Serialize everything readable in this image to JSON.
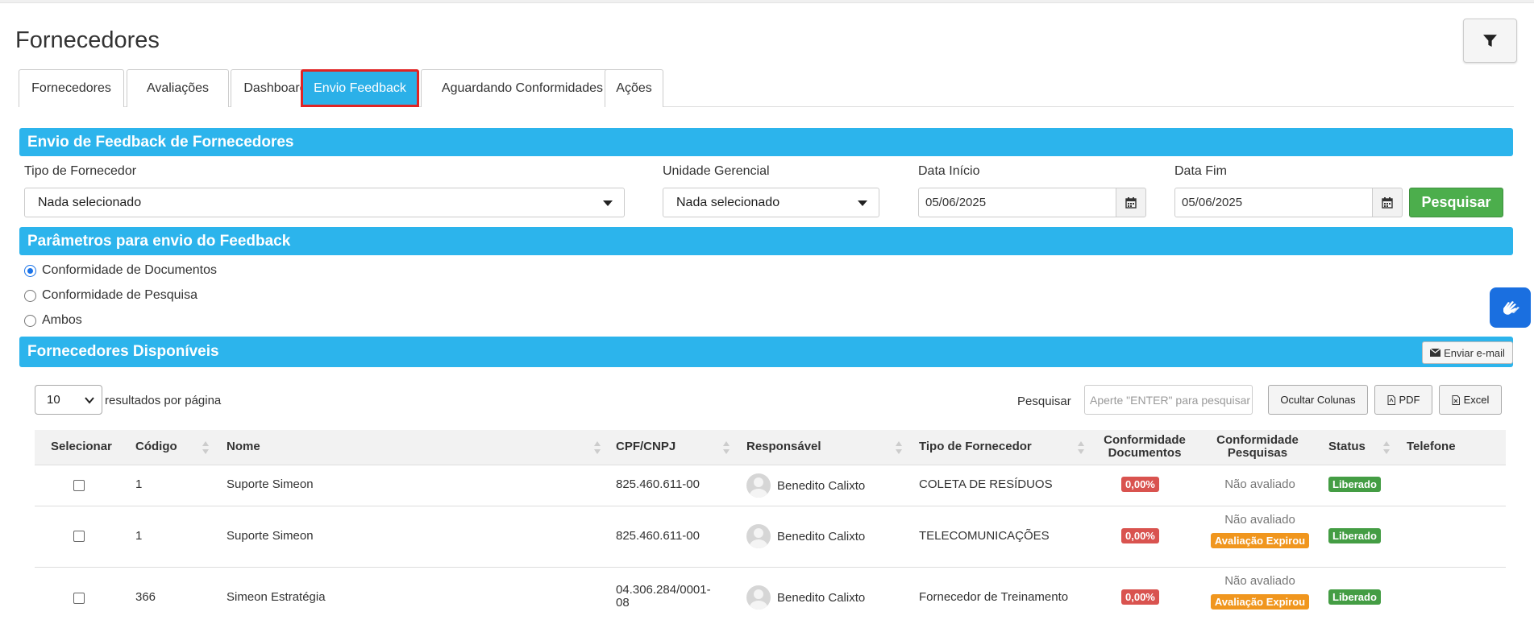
{
  "page": {
    "title": "Fornecedores"
  },
  "tabs": [
    {
      "label": "Fornecedores"
    },
    {
      "label": "Avaliações"
    },
    {
      "label": "Dashboard"
    },
    {
      "label": "Envio Feedback",
      "active": true
    },
    {
      "label": "Aguardando Conformidades"
    },
    {
      "label": "Ações"
    }
  ],
  "filters": {
    "section_title": "Envio de Feedback de Fornecedores",
    "tipo_label": "Tipo de Fornecedor",
    "tipo_value": "Nada selecionado",
    "unidade_label": "Unidade Gerencial",
    "unidade_value": "Nada selecionado",
    "inicio_label": "Data Início",
    "inicio_value": "05/06/2025",
    "fim_label": "Data Fim",
    "fim_value": "05/06/2025",
    "search_button": "Pesquisar"
  },
  "params": {
    "section_title": "Parâmetros para envio do Feedback",
    "options": [
      {
        "label": "Conformidade de Documentos",
        "checked": true
      },
      {
        "label": "Conformidade de Pesquisa",
        "checked": false
      },
      {
        "label": "Ambos",
        "checked": false
      }
    ]
  },
  "list": {
    "section_title": "Fornecedores Disponíveis",
    "email_button": "Enviar e-mail",
    "per_page_value": "10",
    "per_page_text": "resultados por página",
    "search_label": "Pesquisar",
    "search_placeholder": "Aperte \"ENTER\" para pesquisar",
    "hide_columns": "Ocultar Colunas",
    "pdf": "PDF",
    "excel": "Excel"
  },
  "table": {
    "headers": {
      "selecionar": "Selecionar",
      "codigo": "Código",
      "nome": "Nome",
      "cpf": "CPF/CNPJ",
      "responsavel": "Responsável",
      "tipo": "Tipo de Fornecedor",
      "conf_doc_1": "Conformidade",
      "conf_doc_2": "Documentos",
      "conf_pesq_1": "Conformidade",
      "conf_pesq_2": "Pesquisas",
      "status": "Status",
      "telefone": "Telefone"
    },
    "rows": [
      {
        "codigo": "1",
        "nome": "Suporte Simeon",
        "cpf": "825.460.611-00",
        "cpf_2": "",
        "responsavel": "Benedito Calixto",
        "tipo": "COLETA DE RESÍDUOS",
        "conf_doc": "0,00%",
        "conf_pesq": "Não avaliado",
        "conf_pesq_badge": "",
        "status": "Liberado",
        "telefone": ""
      },
      {
        "codigo": "1",
        "nome": "Suporte Simeon",
        "cpf": "825.460.611-00",
        "cpf_2": "",
        "responsavel": "Benedito Calixto",
        "tipo": "TELECOMUNICAÇÕES",
        "conf_doc": "0,00%",
        "conf_pesq": "Não avaliado",
        "conf_pesq_badge": "Avaliação Expirou",
        "status": "Liberado",
        "telefone": ""
      },
      {
        "codigo": "366",
        "nome": "Simeon Estratégia",
        "cpf": "04.306.284/0001-",
        "cpf_2": "08",
        "responsavel": "Benedito Calixto",
        "tipo": "Fornecedor de Treinamento",
        "conf_doc": "0,00%",
        "conf_pesq": "Não avaliado",
        "conf_pesq_badge": "Avaliação Expirou",
        "status": "Liberado",
        "telefone": ""
      }
    ]
  },
  "colors": {
    "accent": "#2cb4ec",
    "success": "#4cae4c",
    "danger": "#d9534f",
    "warning": "#f0961e",
    "highlight": "#e02424"
  },
  "icons": [
    "filter-icon",
    "calendar-icon",
    "envelope-icon",
    "pdf-icon",
    "excel-icon",
    "sign-language-icon",
    "chevron-down-icon",
    "sort-icon",
    "avatar-icon"
  ]
}
